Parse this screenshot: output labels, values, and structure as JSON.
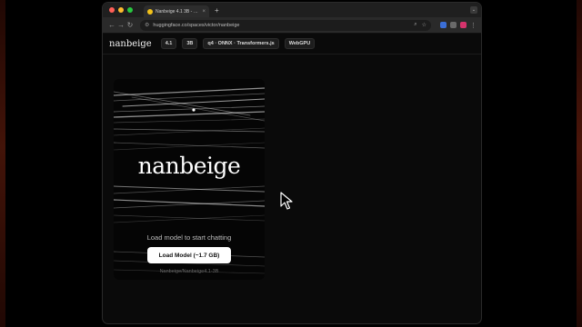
{
  "browser": {
    "tab_title": "Nanbeige 4.1 3B - a Huggin…",
    "tab_close": "×",
    "new_tab": "+",
    "url": "huggingface.co/spaces/victor/nanbeige"
  },
  "header": {
    "brand": "nanbeige",
    "pills": [
      "4.1",
      "3B",
      "q4 · ONNX · Transformers.js",
      "WebGPU"
    ]
  },
  "card": {
    "logo": "nanbeige",
    "status": "Load model to start chatting",
    "load_button": "Load Model (~1.7 GB)",
    "model_id": "Nanbeige/Nanbeige4.1-3B"
  },
  "colors": {
    "page_bg": "#000000",
    "accent_glow": "#8a2812",
    "button_bg": "#ffffff"
  }
}
